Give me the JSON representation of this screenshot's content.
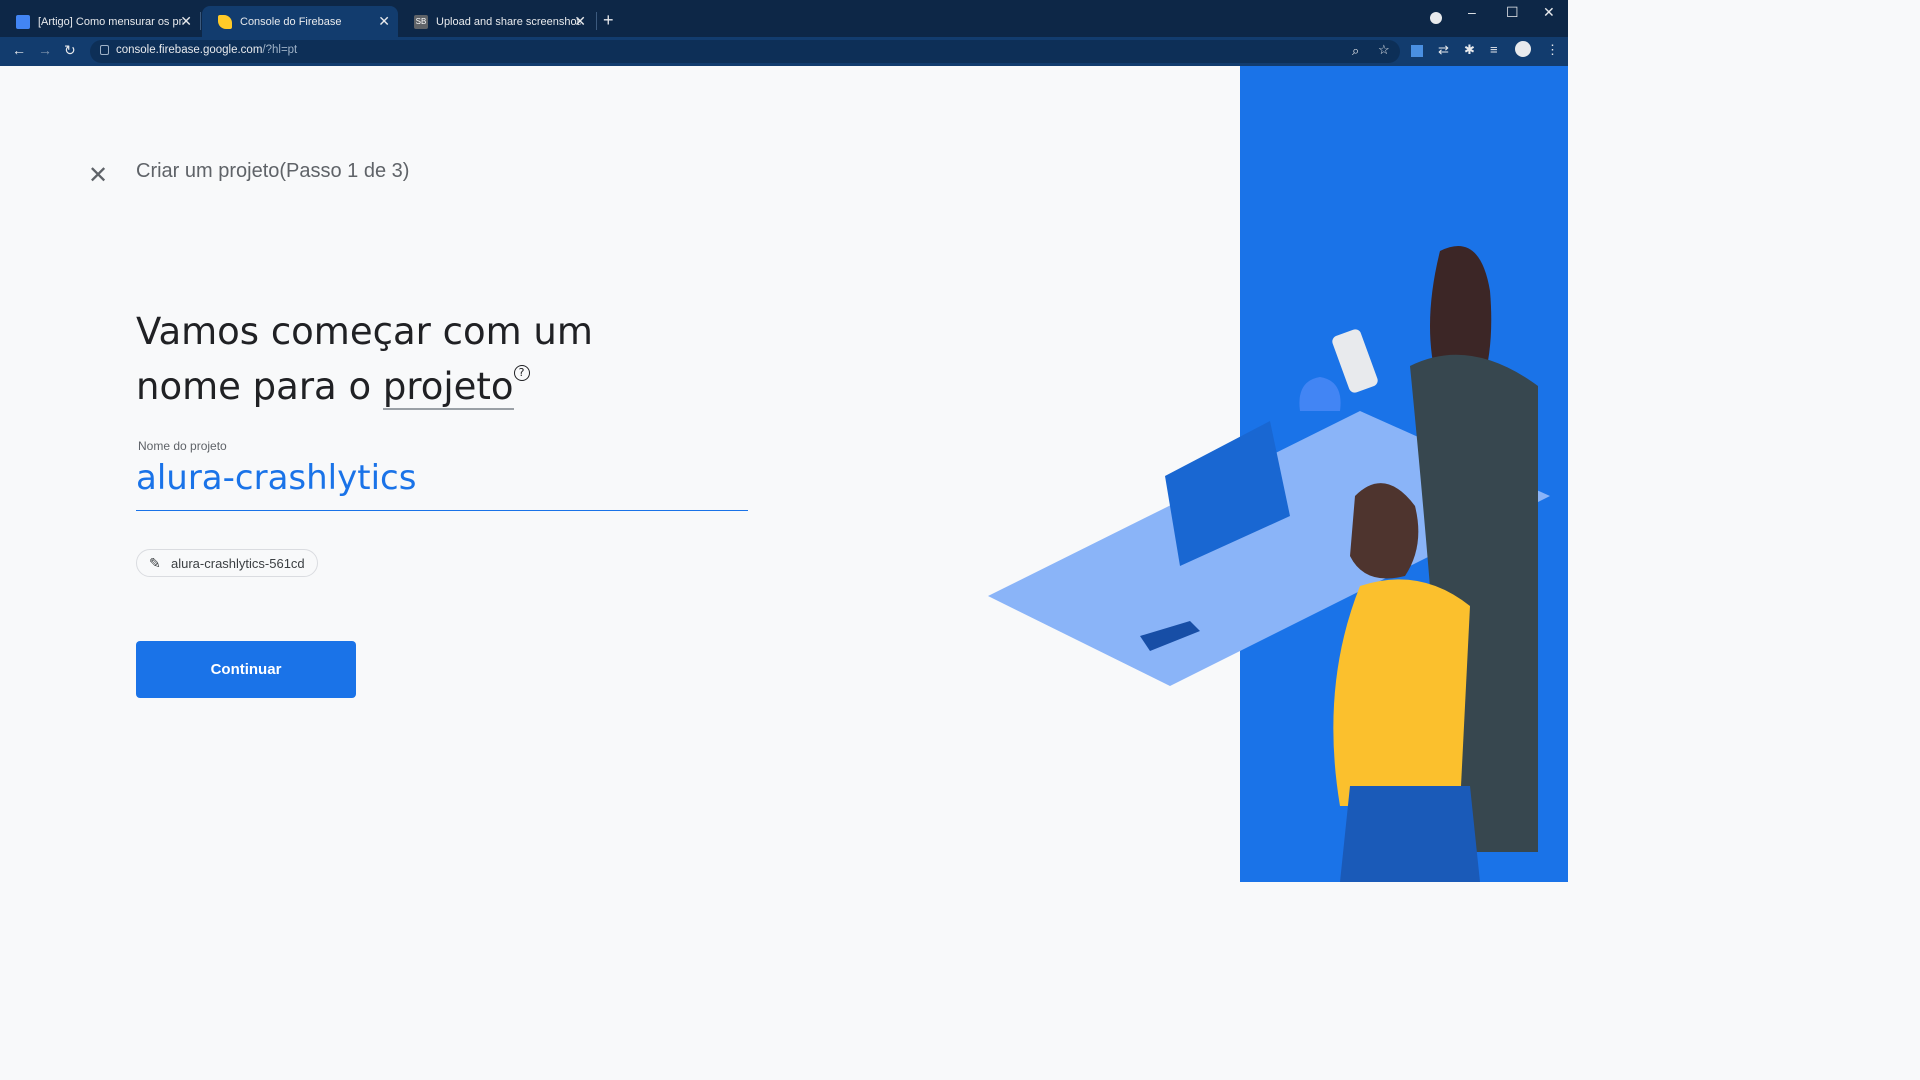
{
  "tabs": [
    {
      "title": "[Artigo] Como mensurar os probl",
      "favicon": "docs-icon",
      "active": false
    },
    {
      "title": "Console do Firebase",
      "favicon": "firebase-icon",
      "active": true
    },
    {
      "title": "Upload and share screenshots an",
      "favicon": "sb-icon",
      "active": false
    }
  ],
  "address_bar": {
    "host": "console.firebase.google.com",
    "path": "/?hl=pt"
  },
  "wizard": {
    "step_title": "Criar um projeto(Passo 1 de 3)",
    "heading_line1": "Vamos começar com um",
    "heading_line2_prefix": "nome para o ",
    "heading_line2_link": "projeto",
    "help_symbol": "?",
    "field_label": "Nome do projeto",
    "field_value": "alura-crashlytics",
    "project_id": "alura-crashlytics-561cd",
    "continue_label": "Continuar"
  },
  "colors": {
    "accent": "#1a73e8",
    "illustration_bg": "#1a73e8"
  }
}
